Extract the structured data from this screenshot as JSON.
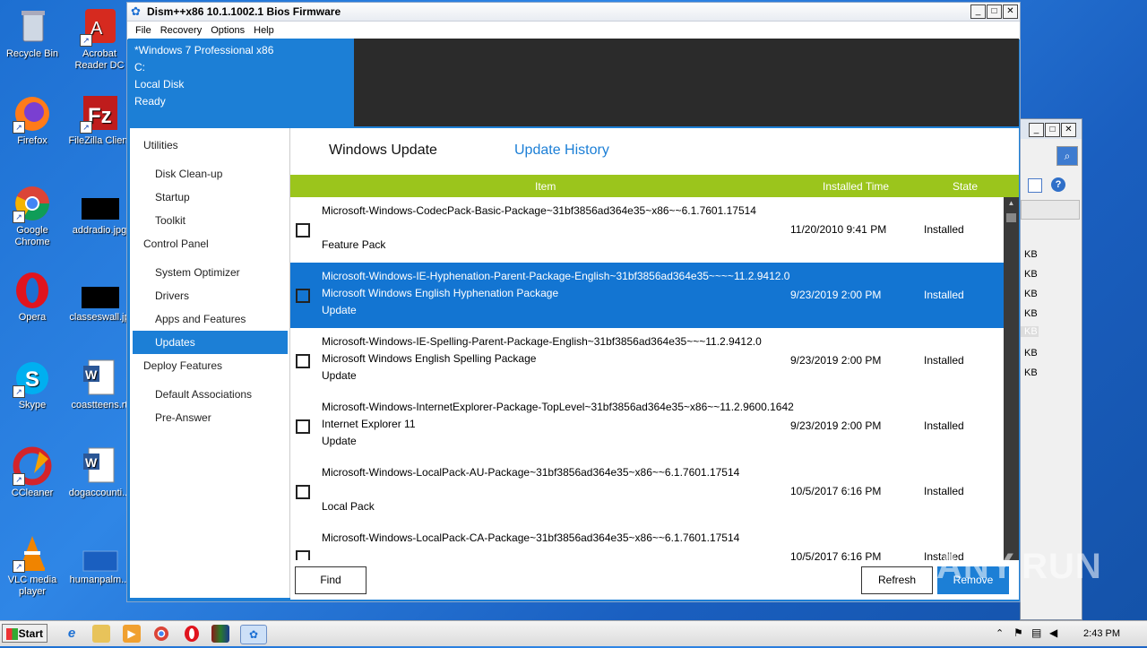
{
  "desktop_icons": [
    {
      "label": "Recycle Bin"
    },
    {
      "label": "Acrobat Reader DC"
    },
    {
      "label": "Firefox"
    },
    {
      "label": "FileZilla Client"
    },
    {
      "label": "Google Chrome"
    },
    {
      "label": "addradio.jpg"
    },
    {
      "label": "Opera"
    },
    {
      "label": "classeswall.jp"
    },
    {
      "label": "Skype"
    },
    {
      "label": "coastteens.rt"
    },
    {
      "label": "CCleaner"
    },
    {
      "label": "dogaccounti..."
    },
    {
      "label": "VLC media player"
    },
    {
      "label": "humanpalm..."
    }
  ],
  "window": {
    "title": "Dism++x86 10.1.1002.1 Bios Firmware",
    "menu": [
      "File",
      "Recovery",
      "Options",
      "Help"
    ]
  },
  "info": {
    "os": "*Windows 7 Professional x86",
    "drive": "C:",
    "disk": "Local Disk",
    "status": "Ready"
  },
  "sidebar": {
    "utilities": "Utilities",
    "utility_items": [
      "Disk Clean-up",
      "Startup",
      "Toolkit"
    ],
    "control_panel": "Control Panel",
    "control_items": [
      "System Optimizer",
      "Drivers",
      "Apps and Features",
      "Updates"
    ],
    "deploy": "Deploy Features",
    "deploy_items": [
      "Default Associations",
      "Pre-Answer"
    ]
  },
  "tabs": {
    "windows_update": "Windows Update",
    "update_history": "Update History"
  },
  "table": {
    "columns": {
      "item": "Item",
      "installed_time": "Installed Time",
      "state": "State"
    },
    "rows": [
      {
        "l1": "Microsoft-Windows-CodecPack-Basic-Package~31bf3856ad364e35~x86~~6.1.7601.17514",
        "l2": "",
        "l3": "Feature Pack",
        "time": "11/20/2010 9:41 PM",
        "state": "Installed",
        "selected": false
      },
      {
        "l1": "Microsoft-Windows-IE-Hyphenation-Parent-Package-English~31bf3856ad364e35~~~~11.2.9412.0",
        "l2": "Microsoft Windows English Hyphenation Package",
        "l3": "Update",
        "time": "9/23/2019 2:00 PM",
        "state": "Installed",
        "selected": true
      },
      {
        "l1": "Microsoft-Windows-IE-Spelling-Parent-Package-English~31bf3856ad364e35~~~11.2.9412.0",
        "l2": "Microsoft Windows English Spelling Package",
        "l3": "Update",
        "time": "9/23/2019 2:00 PM",
        "state": "Installed",
        "selected": false
      },
      {
        "l1": "Microsoft-Windows-InternetExplorer-Package-TopLevel~31bf3856ad364e35~x86~~11.2.9600.1642",
        "l2": "Internet Explorer 11",
        "l3": "Update",
        "time": "9/23/2019 2:00 PM",
        "state": "Installed",
        "selected": false
      },
      {
        "l1": "Microsoft-Windows-LocalPack-AU-Package~31bf3856ad364e35~x86~~6.1.7601.17514",
        "l2": "",
        "l3": "Local Pack",
        "time": "10/5/2017 6:16 PM",
        "state": "Installed",
        "selected": false
      },
      {
        "l1": "Microsoft-Windows-LocalPack-CA-Package~31bf3856ad364e35~x86~~6.1.7601.17514",
        "l2": "",
        "l3": "",
        "time": "10/5/2017 6:16 PM",
        "state": "Installed",
        "selected": false
      }
    ]
  },
  "buttons": {
    "find": "Find",
    "refresh": "Refresh",
    "remove": "Remove"
  },
  "bg_window": {
    "sizes": [
      "KB",
      "KB",
      "KB",
      "KB",
      "KB",
      "KB",
      "KB"
    ]
  },
  "taskbar": {
    "start": "Start",
    "clock": "2:43 PM"
  },
  "watermark": "ANY.RUN",
  "colors": {
    "accent": "#1c7fd6",
    "header_green": "#9bc51c",
    "selected_row": "#1375d2"
  }
}
